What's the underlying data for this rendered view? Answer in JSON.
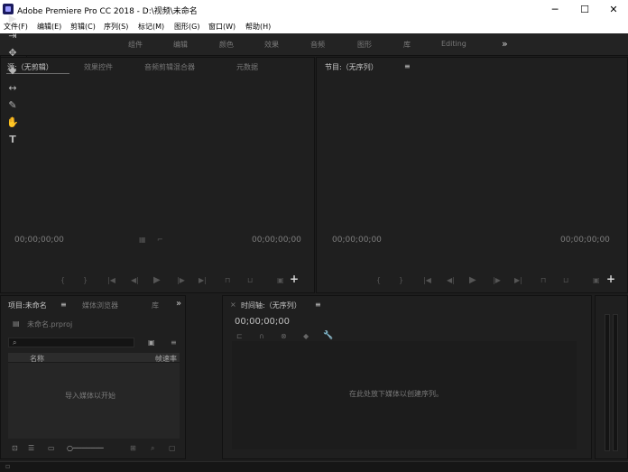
{
  "window": {
    "title": "Adobe Premiere Pro CC 2018 - D:\\视频\\未命名",
    "minimize": "─",
    "maximize": "☐",
    "close": "✕"
  },
  "menu": [
    "文件(F)",
    "编辑(E)",
    "剪辑(C)",
    "序列(S)",
    "标记(M)",
    "图形(G)",
    "窗口(W)",
    "帮助(H)"
  ],
  "workspaces": [
    "组件",
    "编辑",
    "颜色",
    "效果",
    "音频",
    "图形",
    "库",
    "Editing"
  ],
  "workspace_more": "»",
  "source_monitor": {
    "tabs": [
      "源:（无剪辑）",
      "效果控件",
      "音频剪辑混合器",
      "元数据"
    ],
    "timecode_left": "00;00;00;00",
    "timecode_right": "00;00;00;00"
  },
  "program_monitor": {
    "title": "节目:（无序列）",
    "menu": "≡",
    "timecode_left": "00;00;00;00",
    "timecode_right": "00;00;00;00"
  },
  "transport": {
    "add": "+"
  },
  "project": {
    "tabs": [
      "项目:未命名",
      "媒体浏览器",
      "库"
    ],
    "menu": "≡",
    "expand": "»",
    "file": "未命名.prproj",
    "col_name": "名称",
    "col_rate": "帧速率",
    "empty_hint": "导入媒体以开始"
  },
  "timeline": {
    "close": "×",
    "title": "时间轴:（无序列）",
    "menu": "≡",
    "timecode": "00;00;00;00",
    "empty_hint": "在此处放下媒体以创建序列。"
  },
  "icons": {
    "app": "premiere-logo-icon",
    "selection": "▶",
    "track_select": "⇥",
    "ripple": "✥",
    "razor": "◆",
    "slip": "↔",
    "pen": "✎",
    "hand": "✋",
    "type": "T",
    "wrench": "🔧",
    "search": "⌕"
  },
  "colors": {
    "bg": "#1d1d1d",
    "panel": "#1f1f1f",
    "chrome": "#ffffff"
  }
}
